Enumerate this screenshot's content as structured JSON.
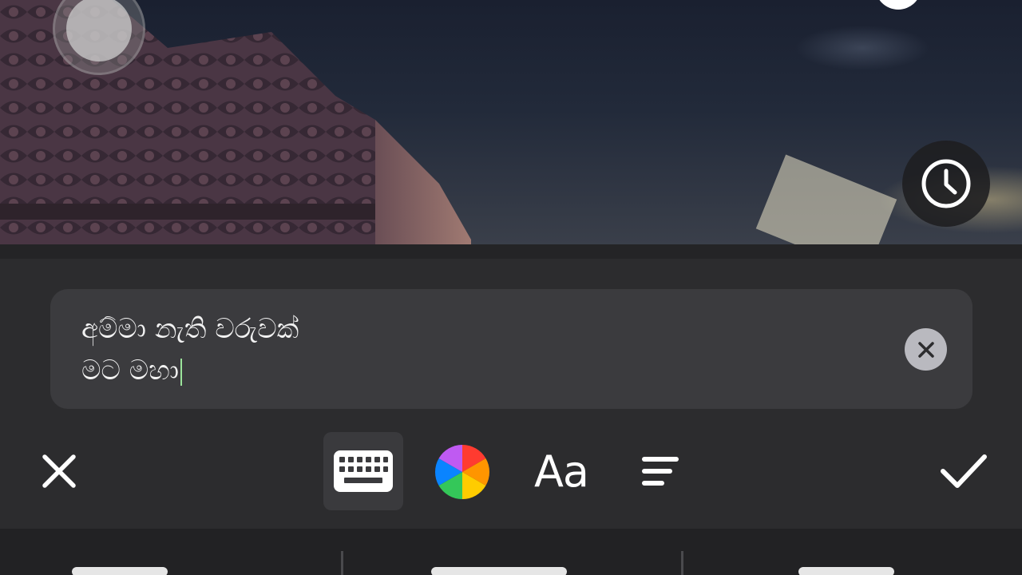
{
  "caption_editor": {
    "text_line_1": "අම්මා නැති වරුවක්",
    "text_line_2": "මට මහා"
  },
  "toolbar": {
    "font_label": "Aa"
  },
  "icons": {
    "joystick": "joystick-icon",
    "clock": "clock-icon",
    "clear": "clear-text-icon",
    "close": "close-icon",
    "keyboard": "keyboard-icon",
    "color": "color-wheel-icon",
    "font": "font-style-icon",
    "align": "text-align-icon",
    "confirm": "checkmark-icon"
  },
  "colors": {
    "panel_background": "#2c2c2e",
    "text_box_background": "#3b3b3e",
    "text": "#f2f2f2",
    "icon": "#ffffff"
  }
}
